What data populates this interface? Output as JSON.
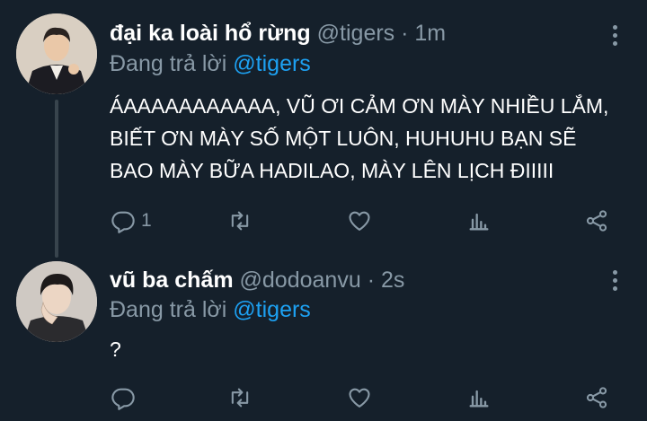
{
  "tweets": [
    {
      "display_name": "đại ka loài hổ rừng",
      "handle": "@tigers",
      "separator": "·",
      "time": "1m",
      "reply_prefix": "Đang trả lời",
      "reply_to": "@tigers",
      "body_lines": [
        "ÁAAAAAAAAAAA, VŨ ƠI CẢM ƠN MÀY NHIỀU LẮM,",
        "BIẾT ƠN MÀY SỐ MỘT LUÔN, HUHUHU BẠN SẼ",
        "BAO MÀY BỮA HADILAO, MÀY LÊN LỊCH ĐIIIII"
      ],
      "reply_count": "1"
    },
    {
      "display_name": "vũ ba chấm",
      "handle": "@dodoanvu",
      "separator": "·",
      "time": "2s",
      "reply_prefix": "Đang trả lời",
      "reply_to": "@tigers",
      "body_lines": [
        "?"
      ],
      "reply_count": ""
    }
  ],
  "icons": {
    "reply": "reply-icon",
    "retweet": "retweet-icon",
    "like": "heart-icon",
    "stats": "stats-icon",
    "share": "share-icon",
    "more": "more-vertical-icon"
  },
  "colors": {
    "background": "#15202b",
    "text_primary": "#ffffff",
    "text_secondary": "#8899a6",
    "accent": "#1da1f2",
    "thread_line": "#38444d"
  }
}
